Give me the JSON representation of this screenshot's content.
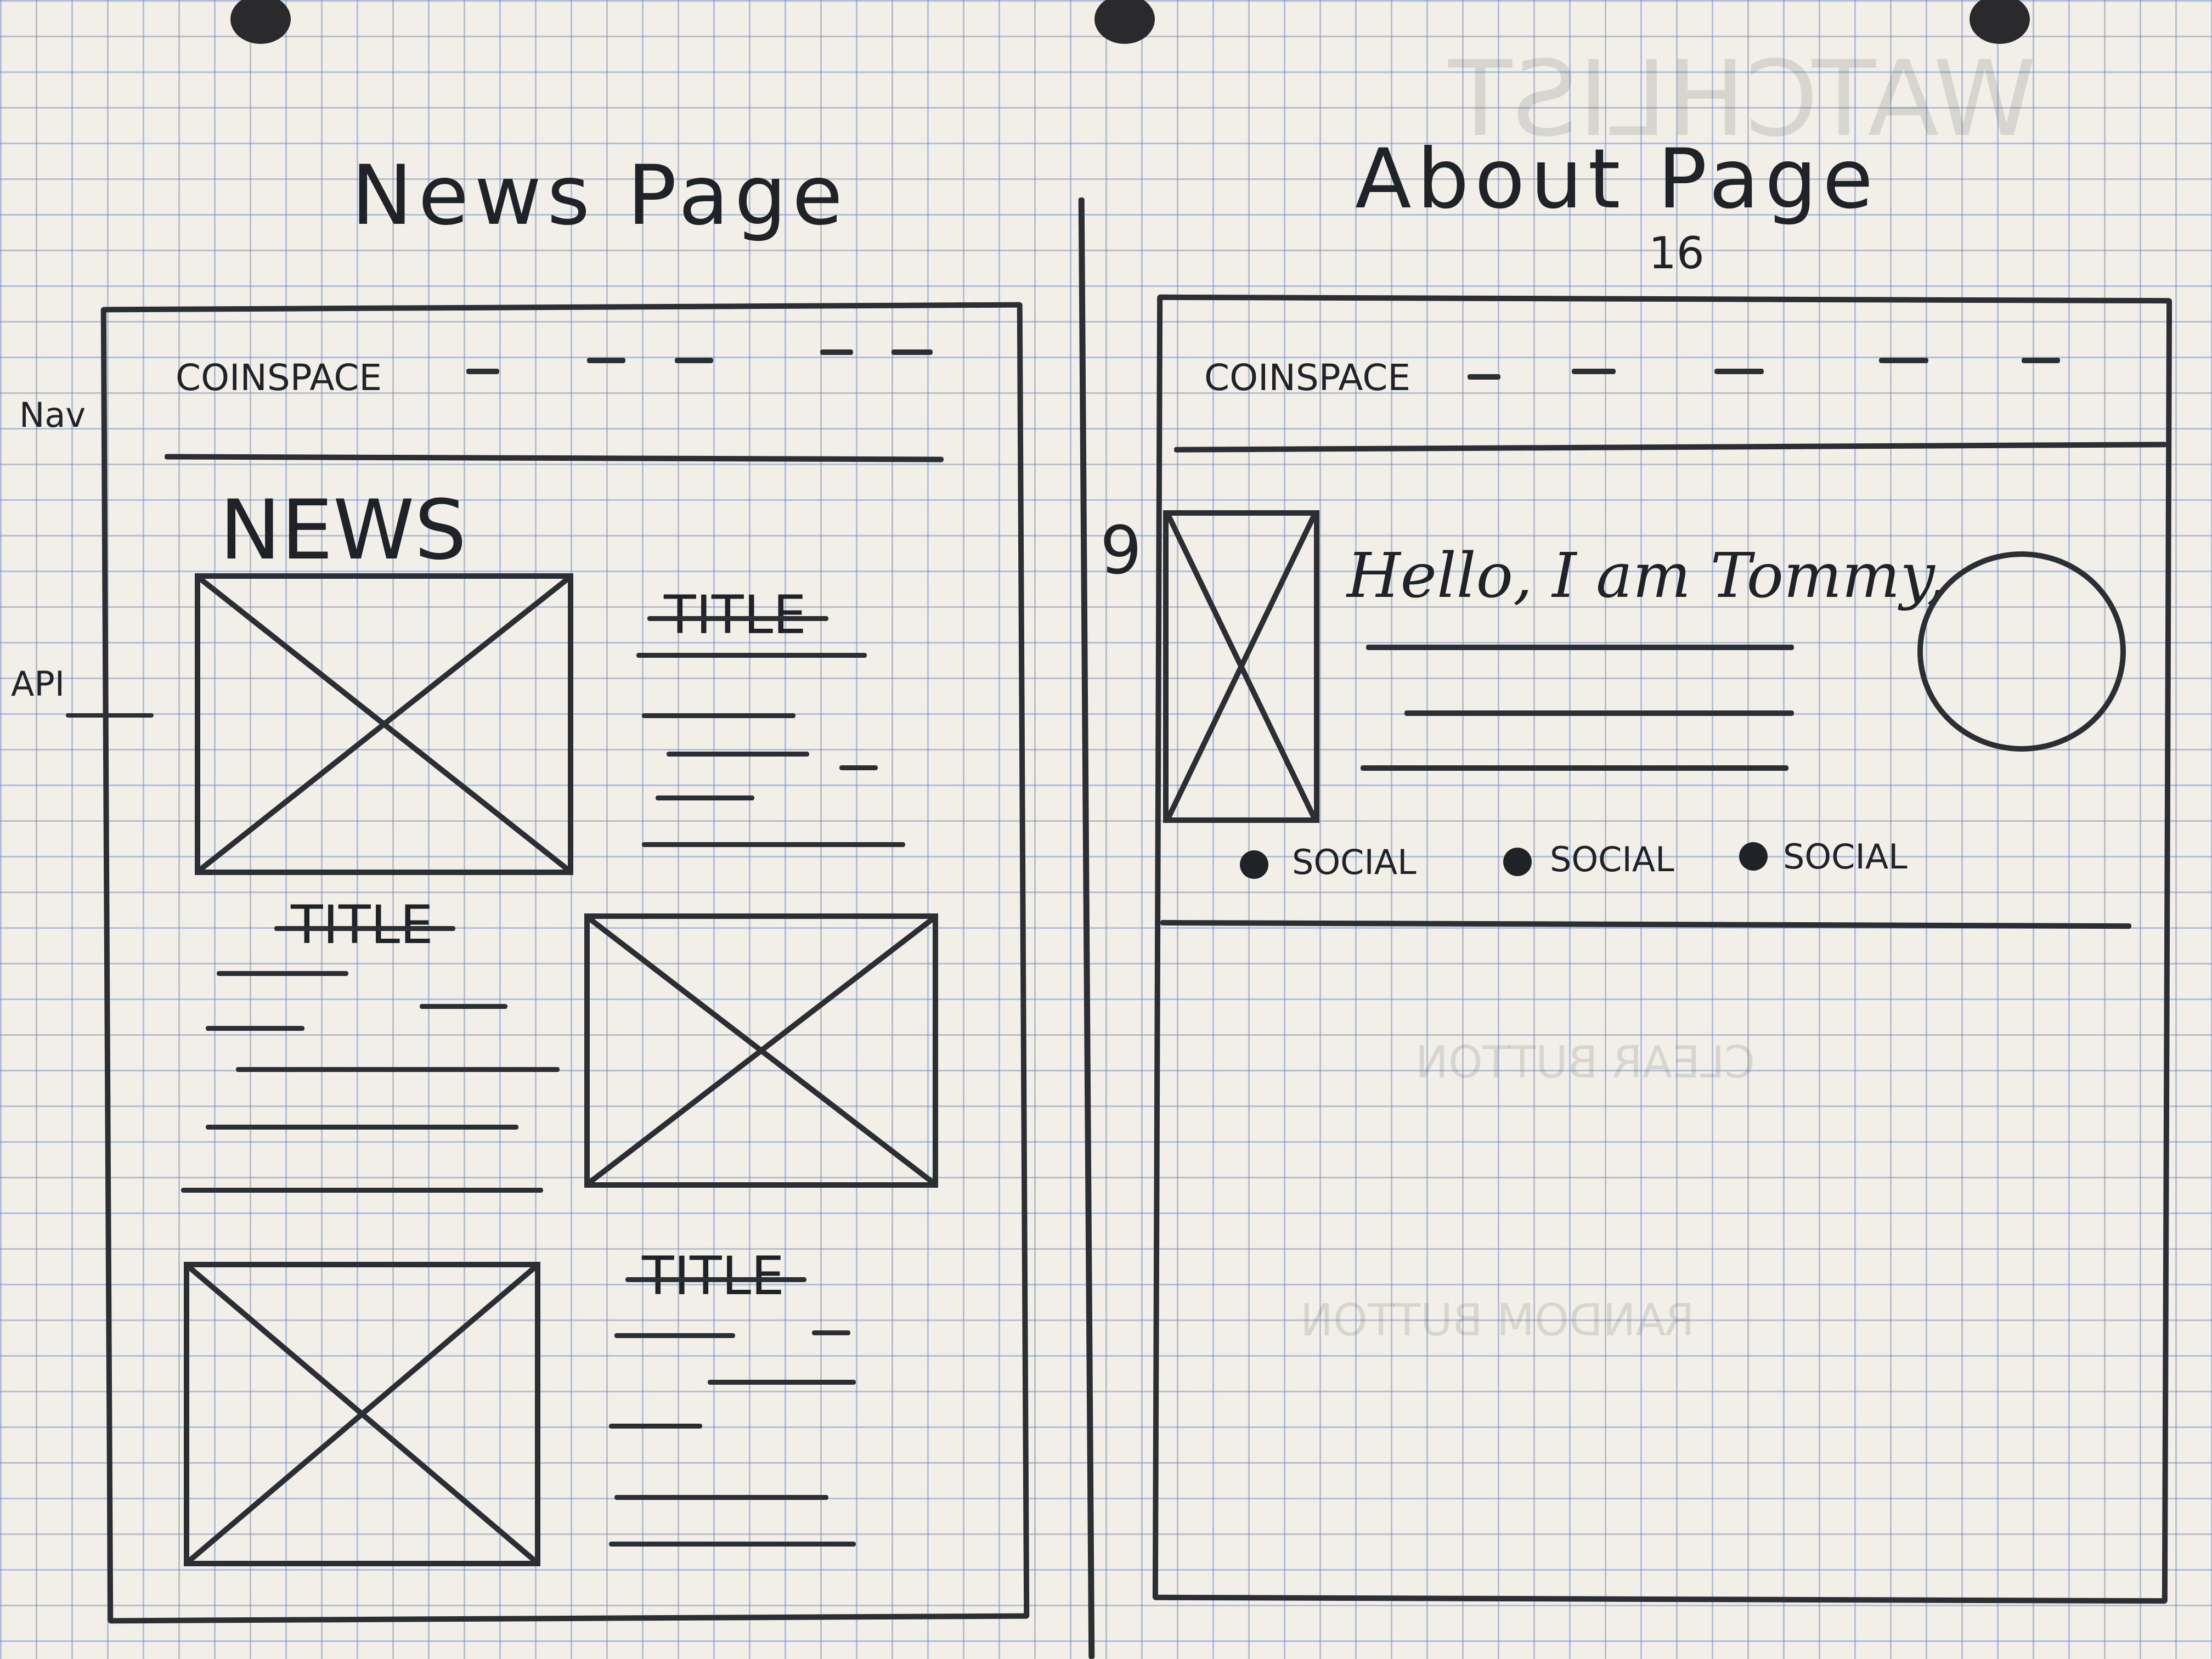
{
  "news_page": {
    "heading": "News Page",
    "nav_label": "Nav",
    "api_label": "API",
    "brand": "COINSPACE",
    "section_heading": "NEWS",
    "article_titles": [
      "TITLE",
      "TITLE",
      "TITLE"
    ]
  },
  "about_page": {
    "heading": "About Page",
    "heading_note": "16",
    "side_note": "9",
    "brand": "COINSPACE",
    "greeting": "Hello, I am Tommy,",
    "socials": [
      "SOCIAL",
      "SOCIAL",
      "SOCIAL"
    ]
  },
  "faint_background_sketch": {
    "heading": "WATCHLIST",
    "notes": [
      "CLEAR BUTTON",
      "RANDOM BUTTON"
    ]
  }
}
